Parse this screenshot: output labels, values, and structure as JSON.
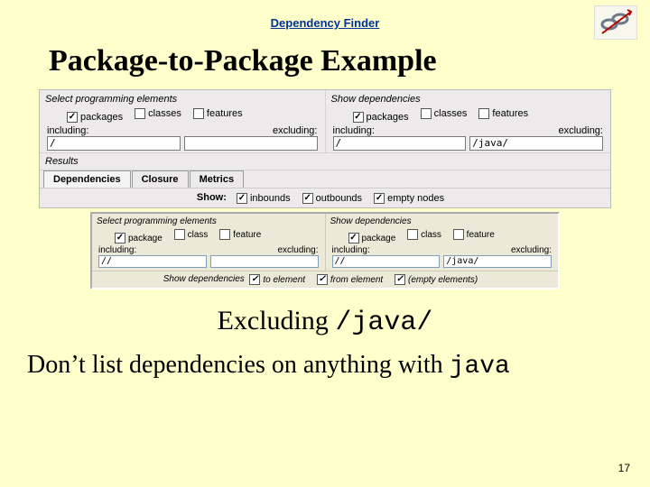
{
  "header": {
    "link_text": "Dependency Finder"
  },
  "title": "Package-to-Package Example",
  "panel1": {
    "left": {
      "section": "Select programming elements",
      "packages": "packages",
      "classes": "classes",
      "features": "features",
      "including": "including:",
      "excluding": "excluding:",
      "inc_val": "/",
      "exc_val": ""
    },
    "right": {
      "section": "Show dependencies",
      "packages": "packages",
      "classes": "classes",
      "features": "features",
      "including": "including:",
      "excluding": "excluding:",
      "inc_val": "/",
      "exc_val": "/java/"
    },
    "results": "Results",
    "tabs": {
      "t1": "Dependencies",
      "t2": "Closure",
      "t3": "Metrics"
    },
    "show": "Show:",
    "inbounds": "inbounds",
    "outbounds": "outbounds",
    "emptynodes": "empty nodes"
  },
  "panel2": {
    "left": {
      "section": "Select programming elements",
      "package": "package",
      "class": "class",
      "feature": "feature",
      "including": "including:",
      "excluding": "excluding:",
      "inc_val": "//",
      "exc_val": ""
    },
    "right": {
      "section": "Show dependencies",
      "package": "package",
      "class": "class",
      "feature": "feature",
      "including": "including:",
      "excluding": "excluding:",
      "inc_val": "//",
      "exc_val": "/java/"
    },
    "showline": "Show dependencies",
    "toelem": "to element",
    "fromelem": "from element",
    "emptyelem": "(empty elements)"
  },
  "subtitle_pre": "Excluding ",
  "subtitle_mono": "/java/",
  "body_pre": "Don’t list dependencies on anything with ",
  "body_mono": "java",
  "page_num": "17"
}
